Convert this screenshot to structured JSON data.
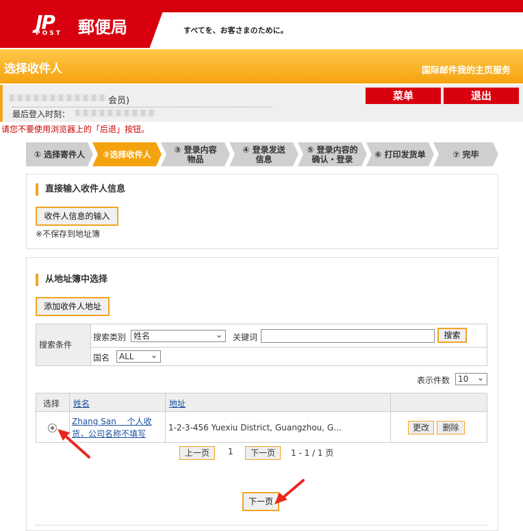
{
  "header": {
    "logo_jp": "JP",
    "logo_post": "POST",
    "logo_name": "郵便局",
    "tagline": "すべてを、お客さまのために。"
  },
  "titlebar": {
    "title": "选择收件人",
    "home_link": "国际邮件我的主页服务"
  },
  "user": {
    "member_suffix": "会员)",
    "last_login_label": "最后登入时刻：",
    "menu_button": "菜单",
    "logout_button": "退出"
  },
  "warning": "请您不要使用浏览器上的「后退」按钮。",
  "steps": [
    {
      "label": "① 选择寄件人"
    },
    {
      "label": "②选择收件人"
    },
    {
      "label": "③ 登录内容\n物品"
    },
    {
      "label": "④ 登录发送\n信息"
    },
    {
      "label": "⑤ 登录内容的\n确认・登录"
    },
    {
      "label": "⑥ 打印发货单"
    },
    {
      "label": "⑦ 完毕"
    }
  ],
  "direct": {
    "title": "直接输入收件人信息",
    "button": "收件人信息的输入",
    "note": "※不保存到地址簿"
  },
  "addressbook": {
    "title": "从地址簿中选择",
    "add_button": "添加收件人地址",
    "search": {
      "label": "搜索条件",
      "category_label": "搜索类别",
      "category_value": "姓名",
      "keyword_label": "关键词",
      "keyword_value": "",
      "search_button": "搜索",
      "country_label": "国名",
      "country_value": "ALL"
    },
    "per_page_label": "表示件数",
    "per_page_value": "10",
    "columns": {
      "select": "选择",
      "name": "姓名",
      "address": "地址"
    },
    "rows": [
      {
        "name": "Zhang San　 个人收货，公司名称不填写",
        "address": "1-2-3-456 Yuexiu District, Guangzhou, G...",
        "edit": "更改",
        "delete": "删除"
      }
    ],
    "pager": {
      "prev": "上一页",
      "current": "1",
      "next": "下一页",
      "range": "1 - 1 / 1 页"
    },
    "next_button": "下一页"
  },
  "colors": {
    "brand_red": "#d8000f",
    "accent_orange": "#f5a20f",
    "annotation_red": "#e8281f"
  }
}
